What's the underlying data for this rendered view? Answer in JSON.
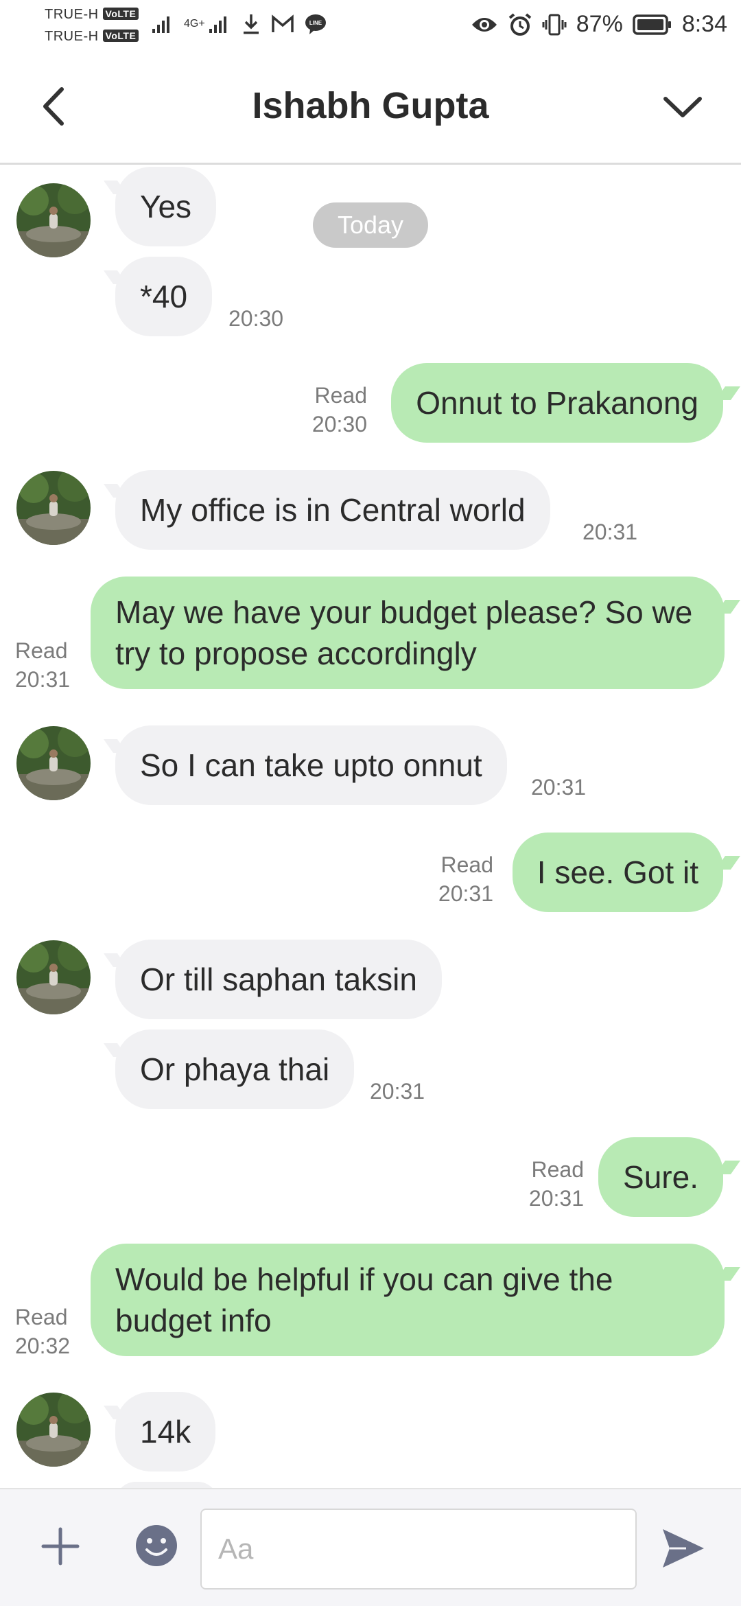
{
  "status_bar": {
    "carrier_1": "TRUE-H",
    "carrier_2": "TRUE-H",
    "volte_badge": "VoLTE",
    "network_type": "4G+",
    "battery": "87%",
    "time": "8:34",
    "icons": [
      "signal-icon",
      "signal-icon",
      "download-icon",
      "gmail-icon",
      "line-icon",
      "eye-icon",
      "alarm-icon",
      "vibrate-icon",
      "battery-icon"
    ]
  },
  "header": {
    "title": "Ishabh Gupta",
    "back_icon": "chevron-left-icon",
    "menu_icon": "chevron-down-icon"
  },
  "chat": {
    "date_divider": "Today",
    "messages": [
      {
        "dir": "in",
        "text": "Yes"
      },
      {
        "dir": "in",
        "text": "*40",
        "time": "20:30"
      },
      {
        "dir": "out",
        "text": "Onnut to Prakanong",
        "status": "Read",
        "time": "20:30"
      },
      {
        "dir": "in",
        "text": "My office is in Central world",
        "time": "20:31"
      },
      {
        "dir": "out",
        "text": "May we have your budget please? So we try to propose accordingly",
        "status": "Read",
        "time": "20:31"
      },
      {
        "dir": "in",
        "text": "So I can take upto onnut",
        "time": "20:31"
      },
      {
        "dir": "out",
        "text": "I see. Got it",
        "status": "Read",
        "time": "20:31"
      },
      {
        "dir": "in",
        "text": "Or till saphan taksin"
      },
      {
        "dir": "in",
        "text": "Or phaya thai",
        "time": "20:31"
      },
      {
        "dir": "out",
        "text": "Sure.",
        "status": "Read",
        "time": "20:31"
      },
      {
        "dir": "out",
        "text": "Would be helpful if you can give the budget info",
        "status": "Read",
        "time": "20:32"
      },
      {
        "dir": "in",
        "text": "14k"
      }
    ]
  },
  "input_bar": {
    "placeholder": "Aa",
    "value": "",
    "plus_icon": "plus-icon",
    "emoji_icon": "emoji-icon",
    "send_icon": "send-icon"
  },
  "colors": {
    "incoming_bubble": "#f1f1f3",
    "outgoing_bubble": "#b8eab4",
    "date_pill": "#c9c9c9",
    "icon_accent": "#6a7088"
  }
}
